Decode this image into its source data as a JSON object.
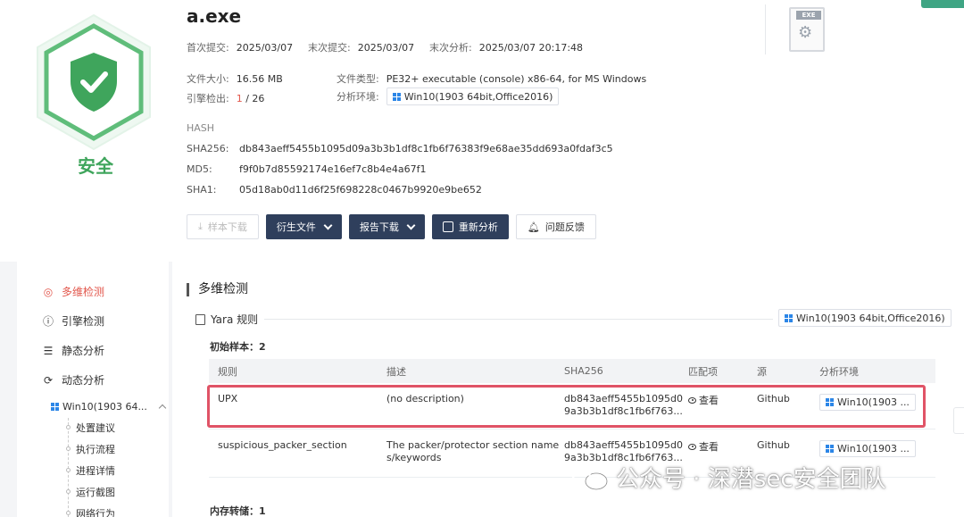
{
  "file": {
    "name": "a.exe",
    "verdict": "安全",
    "first_submit_label": "首次提交:",
    "first_submit": "2025/03/07",
    "last_submit_label": "末次提交:",
    "last_submit": "2025/03/07",
    "last_analysis_label": "末次分析:",
    "last_analysis": "2025/03/07 20:17:48",
    "size_label": "文件大小:",
    "size": "16.56 MB",
    "type_label": "文件类型:",
    "type": "PE32+ executable (console) x86-64, for MS Windows",
    "engine_label": "引擎检出:",
    "engine_hits": "1",
    "engine_total": "/ 26",
    "env_label": "分析环境:",
    "env": "Win10(1903 64bit,Office2016)",
    "file_icon_tag": "EXE"
  },
  "hash": {
    "title": "HASH",
    "sha256_label": "SHA256:",
    "sha256": "db843aeff5455b1095d09a3b3b1df8c1fb6f76383f9e68ae35dd693a0fdaf3c5",
    "md5_label": "MD5:",
    "md5": "f9f0b7d85592174e16ef7c8b4e4a67f1",
    "sha1_label": "SHA1:",
    "sha1": "05d18ab0d11d6f25f698228c0467b9920e9be652"
  },
  "actions": {
    "sample_download": "样本下载",
    "derived_files": "衍生文件",
    "report_download": "报告下载",
    "reanalyze": "重新分析",
    "feedback": "问题反馈"
  },
  "nav": {
    "multi_detect": "多维检测",
    "engine_detect": "引擎检测",
    "static_analysis": "静态分析",
    "dynamic_analysis": "动态分析",
    "env_item": "Win10(1903 64...",
    "sub_items": [
      "处置建议",
      "执行流程",
      "进程详情",
      "运行截图",
      "网络行为"
    ]
  },
  "main": {
    "section_title": "多维检测",
    "yara_title": "Yara 规则",
    "env": "Win10(1903 64bit,Office2016)",
    "initial_sample": "初始样本：2",
    "memory_dump": "内存转储：1",
    "columns": [
      "规则",
      "描述",
      "SHA256",
      "匹配项",
      "源",
      "分析环境"
    ],
    "rows": [
      {
        "rule": "UPX",
        "desc": "(no description)",
        "sha_line1": "db843aeff5455b1095d0",
        "sha_line2": "9a3b3b1df8c1fb6f763...",
        "match": "查看",
        "source": "Github",
        "env": "Win10(1903 ..."
      },
      {
        "rule": "suspicious_packer_section",
        "desc_line1": "The packer/protector section name",
        "desc_line2": "s/keywords",
        "sha_line1": "db843aeff5455b1095d0",
        "sha_line2": "9a3b3b1df8c1fb6f763...",
        "match": "查看",
        "source": "Github",
        "env": "Win10(1903 ..."
      }
    ]
  },
  "watermark": {
    "text": "公众号 · 深潜sec安全团队"
  },
  "colors": {
    "safe": "#3fa55c",
    "accent_red": "#e2574c",
    "dark_button": "#2f3f5c",
    "highlight": "#e05366"
  }
}
